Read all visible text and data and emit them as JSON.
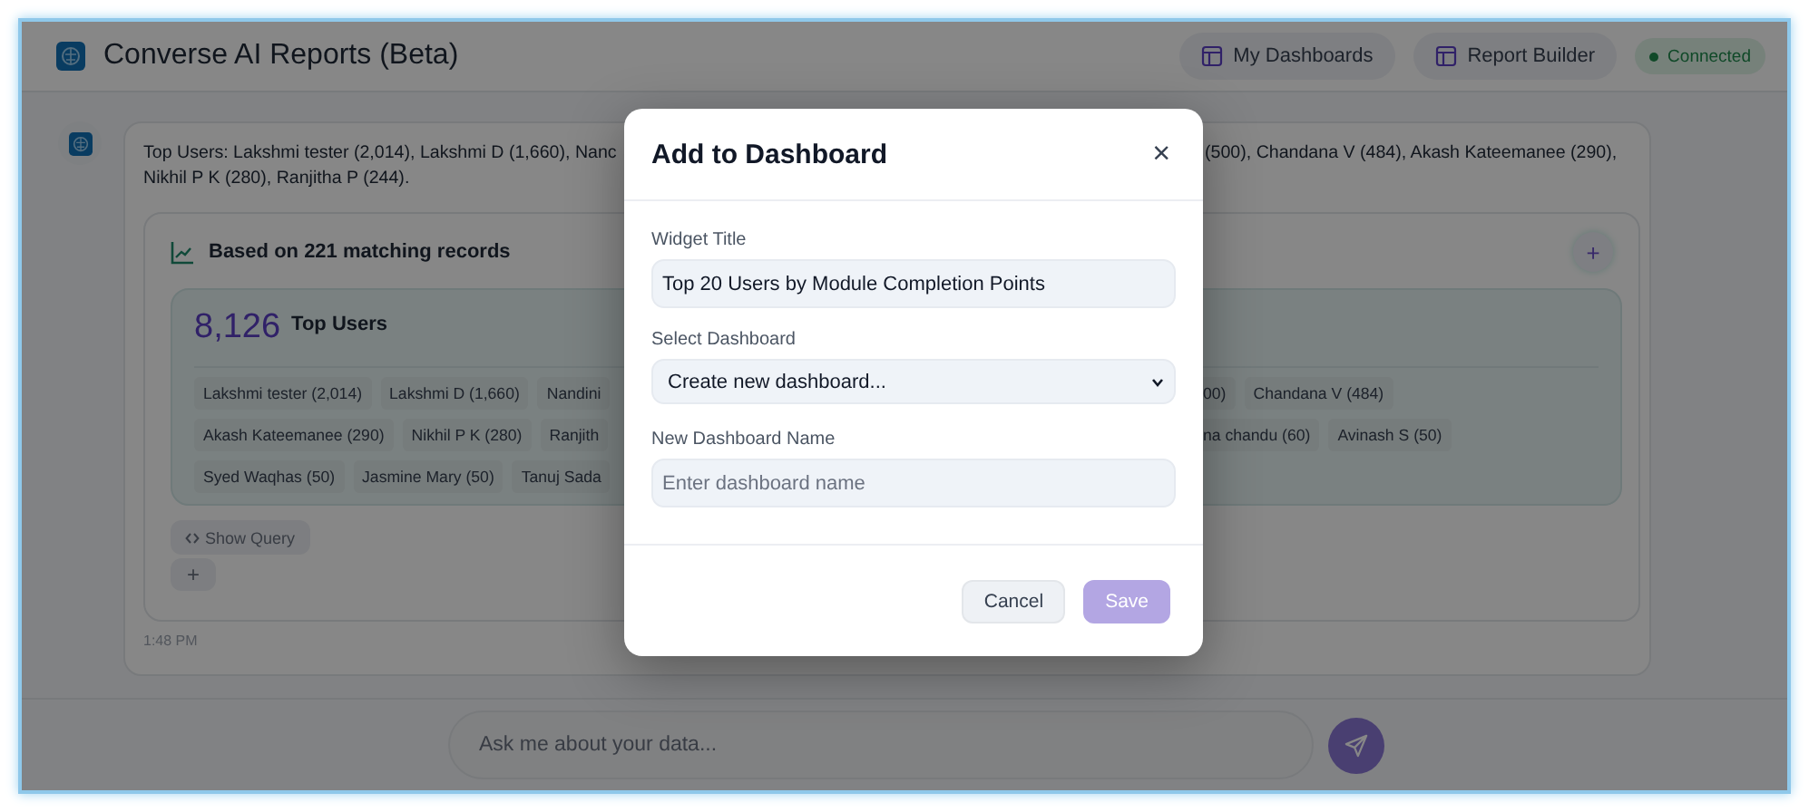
{
  "header": {
    "title": "Converse AI Reports (Beta)",
    "nav_buttons": [
      {
        "label": "My Dashboards"
      },
      {
        "label": "Report Builder"
      }
    ],
    "status": {
      "label": "Connected"
    }
  },
  "message": {
    "summary_left": [
      "Top Users: Lakshmi tester (2,014), Lakshmi D (1,660), Nanc",
      "Nikhil P K (280), Ranjitha P (244)."
    ],
    "summary_right": [
      "(500), Chandana V (484), Akash Kateemanee (290),"
    ],
    "result": {
      "caption": "Based on 221 matching records",
      "add_label": "+",
      "stat": {
        "value": "8,126",
        "label": "Top Users"
      },
      "chip_rows": [
        {
          "left": [
            "Lakshmi tester (2,014)",
            "Lakshmi D (1,660)",
            "Nandini"
          ],
          "right": [
            "00)",
            "Chandana V (484)"
          ]
        },
        {
          "left": [
            "Akash Kateemanee (290)",
            "Nikhil P K (280)",
            "Ranjith"
          ],
          "right": [
            "na chandu (60)",
            "Avinash S (50)"
          ]
        },
        {
          "left": [
            "Syed Waqhas (50)",
            "Jasmine Mary (50)",
            "Tanuj Sada"
          ],
          "right": []
        }
      ],
      "show_query": "Show Query",
      "add_below": "+"
    },
    "time": "1:48 PM"
  },
  "chat_input": {
    "placeholder": "Ask me about your data..."
  },
  "dialog": {
    "title": "Add to Dashboard",
    "close": "×",
    "fields": [
      {
        "kind": "text",
        "label": "Widget Title",
        "value": "Top 20 Users by Module Completion Points"
      },
      {
        "kind": "select",
        "label": "Select Dashboard",
        "value": "Create new dashboard..."
      },
      {
        "kind": "text",
        "label": "New Dashboard Name",
        "placeholder": "Enter dashboard name"
      }
    ],
    "buttons": [
      {
        "label": "Cancel",
        "kind": "secondary",
        "disabled": false
      },
      {
        "label": "Save",
        "kind": "primary",
        "disabled": true
      }
    ]
  }
}
